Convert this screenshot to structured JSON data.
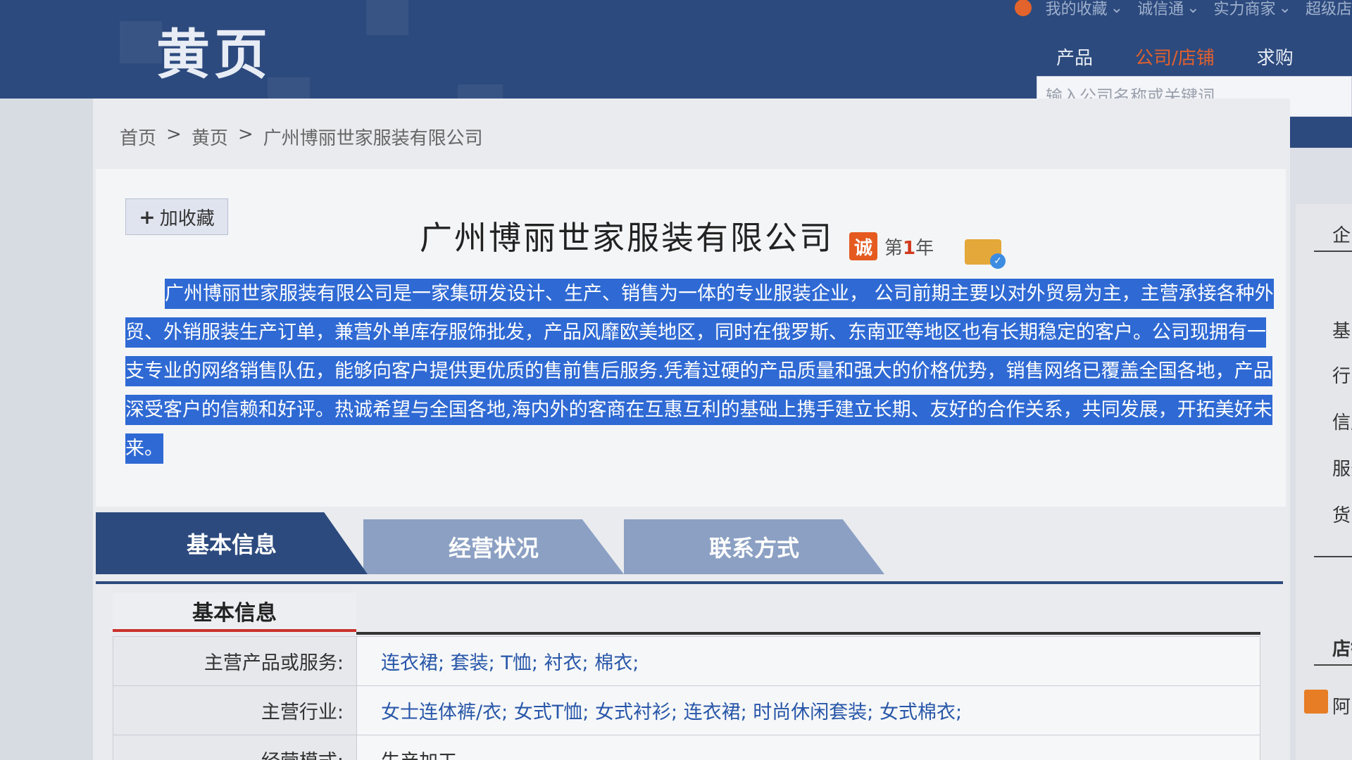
{
  "header": {
    "logo": "黄页",
    "top_links": [
      "我的收藏",
      "诚信通",
      "实力商家",
      "超级店"
    ],
    "nav_tabs": [
      "产品",
      "公司/店铺",
      "求购"
    ],
    "search_placeholder": "输入公司名称或关键词"
  },
  "breadcrumb": [
    "首页",
    "黄页",
    "广州博丽世家服装有限公司"
  ],
  "company": {
    "favorite_label": "加收藏",
    "name": "广州博丽世家服装有限公司",
    "cheng_badge": "诚",
    "year_prefix": "第",
    "year_num": "1",
    "year_suffix": "年",
    "description": "广州博丽世家服装有限公司是一家集研发设计、生产、销售为一体的专业服装企业， 公司前期主要以对外贸易为主，主营承接各种外贸、外销服装生产订单，兼营外单库存服饰批发，产品风靡欧美地区，同时在俄罗斯、东南亚等地区也有长期稳定的客户。公司现拥有一支专业的网络销售队伍，能够向客户提供更优质的售前售后服务.凭着过硬的产品质量和强大的价格优势，销售网络已覆盖全国各地，产品深受客户的信赖和好评。热诚希望与全国各地,海内外的客商在互惠互利的基础上携手建立长期、友好的合作关系，共同发展，开拓美好未来。"
  },
  "info_tabs": [
    "基本信息",
    "经营状况",
    "联系方式"
  ],
  "basic_info": {
    "section_title": "基本信息",
    "rows": [
      {
        "key": "主营产品或服务:",
        "value": "连衣裙; 套装; T恤; 衬衣; 棉衣;"
      },
      {
        "key": "主营行业:",
        "value": "女士连体裤/衣; 女式T恤; 女式衬衫; 连衣裙; 时尚休闲套装; 女式棉衣;"
      },
      {
        "key": "经营模式:",
        "value": "生产加工"
      }
    ]
  },
  "sidebar": {
    "items": [
      "企",
      "基",
      "行",
      "信用",
      "服务",
      "货品",
      "店铺",
      "阿"
    ]
  },
  "colors": {
    "header_bg": "#2c4a7e",
    "selection_bg": "#2f69d4",
    "accent_red": "#c8322b",
    "link_blue": "#2856a8"
  }
}
